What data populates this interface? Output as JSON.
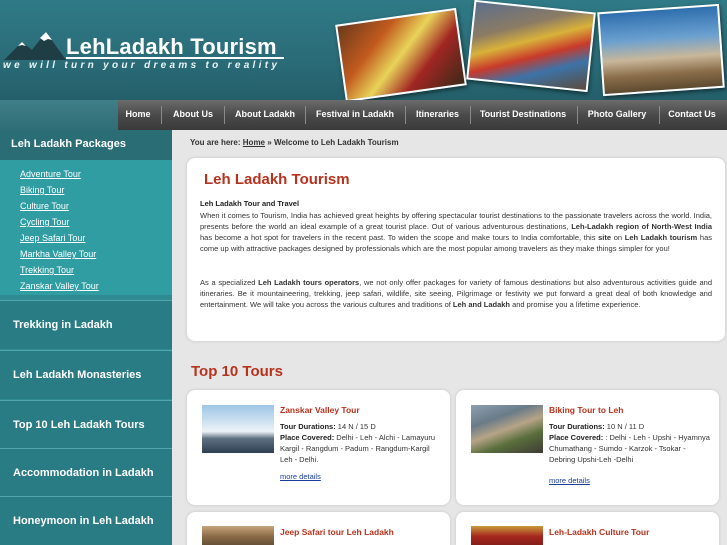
{
  "header": {
    "logo_title": "LehLadakh Tourism",
    "tagline": "we will turn your dreams to reality",
    "brand_color": "#2f7a86"
  },
  "nav": {
    "items": [
      "Home",
      "About Us",
      "About Ladakh",
      "Festival in Ladakh",
      "Itineraries",
      "Tourist Destinations",
      "Photo Gallery",
      "Contact Us"
    ]
  },
  "sidebar": {
    "packages_heading": "Leh Ladakh Packages",
    "package_links": [
      "Adventure Tour",
      "Biking Tour",
      "Culture Tour",
      "Cycling Tour",
      "Jeep Safari Tour",
      "Markha Valley Tour",
      "Trekking Tour",
      "Zanskar Valley Tour"
    ],
    "blocks": [
      "Trekking in Ladakh",
      "Leh Ladakh Monasteries",
      "Top 10 Leh Ladakh Tours",
      "Accommodation in Ladakh",
      "Honeymoon in Leh Ladakh"
    ]
  },
  "breadcrumb": {
    "prefix": "You are here:",
    "home": "Home",
    "separator": "»",
    "current": "Welcome to Leh Ladakh Tourism"
  },
  "intro": {
    "title": "Leh Ladakh Tourism",
    "subtitle": "Leh Ladakh Tour and Travel",
    "p1_a": "When it comes to Tourism, India has achieved great heights by offering spectacular tourist destinations to the passionate travelers across the world. India, presents before the world an ideal example of a great tourist place. Out of various adventurous destinations, ",
    "p1_b": "Leh-Ladakh region of North-West India",
    "p1_c": " has become a hot spot for travelers in the recent past. To widen the scope and make tours to India comfortable, this ",
    "p1_d": "site",
    "p1_e": " on ",
    "p1_f": "Leh Ladakh tourism",
    "p1_g": " has come up with attractive packages designed by professionals which are the most popular among travelers as they make things simpler for you!",
    "p2_a": "As a specialized ",
    "p2_b": "Leh Ladakh tours operators",
    "p2_c": ", we not only offer packages for variety of famous destinations but also adventurous activities guide and itineraries. Be it mountaineering, trekking, jeep safari, wildlife, site seeing, Pilgrimage or festivity we put forward a great deal of both knowledge and entertainment. We will take you across the various cultures and traditions of ",
    "p2_d": "Leh and Ladakh",
    "p2_e": " and promise you a lifetime experience."
  },
  "top10": {
    "title": "Top 10 Tours",
    "duration_label": "Tour Durations:",
    "covered_label": "Place Covered:",
    "more_label": "more details",
    "tours": [
      {
        "title": "Zanskar Valley Tour",
        "duration": "14 N / 15 D",
        "places": "Delhi - Leh - Alchi - Lamayuru Kargil - Rangdum - Padum - Rangdum-Kargil Leh - Delhi."
      },
      {
        "title": "Biking Tour to Leh",
        "duration": "10 N / 11 D",
        "places": ": Delhi - Leh - Upshi - Hyamnya Chumathang - Sumdo - Karzok - Tsokar -Debring Upshi-Leh -Delhi"
      },
      {
        "title": "Jeep Safari tour Leh Ladakh",
        "duration": "",
        "places": ""
      },
      {
        "title": "Leh-Ladakh Culture Tour",
        "duration": "",
        "places": ""
      }
    ]
  }
}
